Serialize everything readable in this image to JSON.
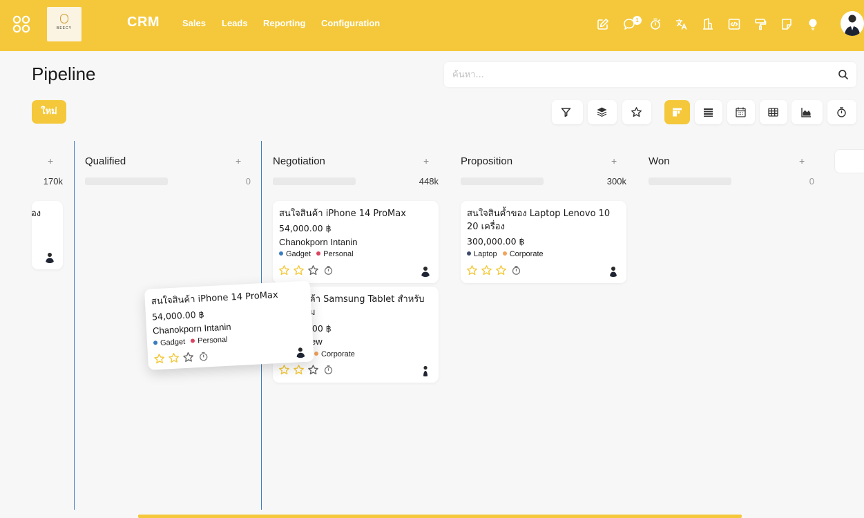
{
  "topbar": {
    "app_name": "CRM",
    "logo_text": "BEECY",
    "nav": [
      "Sales",
      "Leads",
      "Reporting",
      "Configuration"
    ],
    "message_count": "1",
    "accent_color": "#f4c83a",
    "icons": [
      "edit-icon",
      "chat-icon",
      "stopwatch-icon",
      "translate-icon",
      "building-icon",
      "code-icon",
      "paint-roller-icon",
      "note-icon",
      "lightbulb-icon"
    ]
  },
  "header": {
    "title": "Pipeline",
    "search_placeholder": "ค้นหา...",
    "new_label": "ใหม่",
    "active_view": "kanban"
  },
  "columns": [
    {
      "title": "",
      "total": "170k"
    },
    {
      "title": "Qualified",
      "total": "0"
    },
    {
      "title": "Negotiation",
      "total": "448k"
    },
    {
      "title": "Proposition",
      "total": "300k"
    },
    {
      "title": "Won",
      "total": "0"
    }
  ],
  "add_symbol": "+",
  "cards": {
    "partial": {
      "title_fragment": "อง"
    },
    "negotiation_1": {
      "title": "สนใจสินค้า iPhone 14 ProMax",
      "amount": "54,000.00 ฿",
      "customer": "Chanokporn Intanin",
      "tags": [
        {
          "label": "Gadget",
          "color": "#3b7bbf"
        },
        {
          "label": "Personal",
          "color": "#d9455f"
        }
      ],
      "stars": 2
    },
    "negotiation_2": {
      "title_line1": "ค้า Samsung Tablet สำหรับ",
      "title_line2": "ม",
      "amount": "0.00 ฿",
      "customer": "ew",
      "tags": [
        {
          "label": "Corporate",
          "color": "#f0a35c"
        }
      ],
      "stars": 2
    },
    "proposition_1": {
      "title": "สนใจสินค้ำของ Laptop Lenovo 10 20 เครื่อง",
      "amount": "300,000.00 ฿",
      "tags": [
        {
          "label": "Laptop",
          "color": "#3b4a6b"
        },
        {
          "label": "Corporate",
          "color": "#f0a35c"
        }
      ],
      "stars": 3
    },
    "dragging": {
      "title": "สนใจสินค้า iPhone 14 ProMax",
      "amount": "54,000.00 ฿",
      "customer": "Chanokporn Intanin",
      "tags": [
        {
          "label": "Gadget",
          "color": "#3b7bbf"
        },
        {
          "label": "Personal",
          "color": "#d9455f"
        }
      ],
      "stars": 2
    }
  }
}
